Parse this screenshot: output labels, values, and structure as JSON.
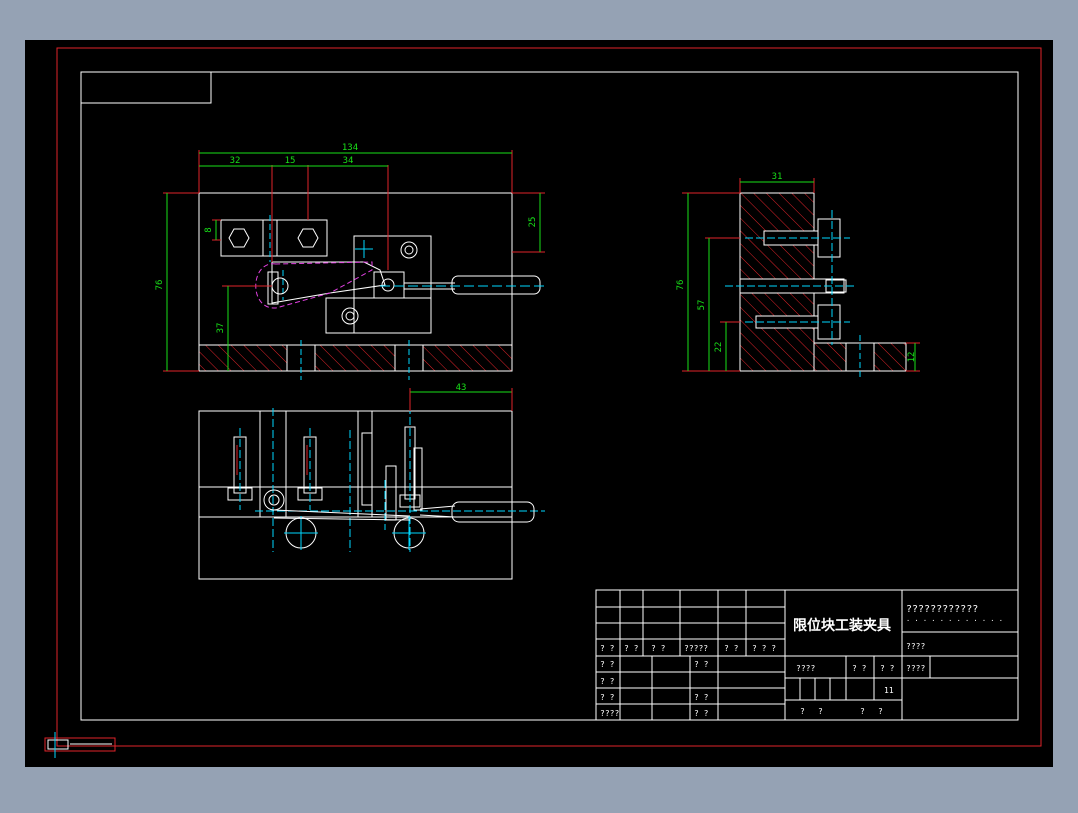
{
  "colors": {
    "app_background": "#95a2b4",
    "canvas": "#000000",
    "border": "#e0232a",
    "outline": "#ffffff",
    "dimension": "#18e018",
    "centerline": "#00d8ff",
    "hatch": "#e0232a",
    "magenta": "#e040e0",
    "title_text": "#ffffff"
  },
  "drawing": {
    "title": "限位块工装夹具",
    "front_view": {
      "dim_total_width": "134",
      "dim_a": "32",
      "dim_b": "15",
      "dim_c": "34",
      "dim_height": "76",
      "dim_small_a": "8",
      "dim_right": "25",
      "dim_low": "37"
    },
    "side_view": {
      "dim_top": "31",
      "dim_height": "76",
      "dim_mid": "57",
      "dim_low": "22",
      "dim_right": "12"
    },
    "top_view": {
      "dim_handle": "43"
    }
  },
  "title_block": {
    "rev_labels": [
      "? ?",
      "? ?",
      "? ?",
      "?????",
      "? ?",
      "? ? ?"
    ],
    "left_rows": [
      "? ?",
      "? ?",
      "? ?",
      "????"
    ],
    "mid_rows": [
      "? ?",
      "? ?",
      "? ?"
    ],
    "top_right": "????????????",
    "top_right_dots": "· · · · · · · · · · · ·",
    "material_label": "????",
    "scale_label": "????",
    "weight_label": "? ?",
    "ratio_label": "? ?",
    "sheet_info": "????",
    "value_11": "11",
    "bottom_labels": [
      "?",
      "?",
      "?",
      "?"
    ]
  }
}
